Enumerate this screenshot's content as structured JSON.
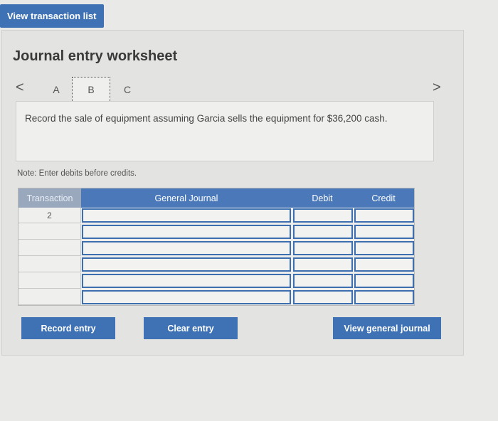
{
  "top_button": "View transaction list",
  "worksheet": {
    "title": "Journal entry worksheet",
    "nav_prev": "<",
    "nav_next": ">",
    "tabs": [
      "A",
      "B",
      "C"
    ],
    "active_tab": "B",
    "instruction": "Record the sale of equipment assuming Garcia sells the equipment for $36,200 cash.",
    "note": "Note: Enter debits before credits."
  },
  "table": {
    "headers": [
      "Transaction",
      "General Journal",
      "Debit",
      "Credit"
    ],
    "rows": [
      {
        "transaction": "2",
        "general_journal": "",
        "debit": "",
        "credit": ""
      },
      {
        "transaction": "",
        "general_journal": "",
        "debit": "",
        "credit": ""
      },
      {
        "transaction": "",
        "general_journal": "",
        "debit": "",
        "credit": ""
      },
      {
        "transaction": "",
        "general_journal": "",
        "debit": "",
        "credit": ""
      },
      {
        "transaction": "",
        "general_journal": "",
        "debit": "",
        "credit": ""
      },
      {
        "transaction": "",
        "general_journal": "",
        "debit": "",
        "credit": ""
      }
    ]
  },
  "buttons": {
    "record": "Record entry",
    "clear": "Clear entry",
    "view_journal": "View general journal"
  },
  "colors": {
    "accent": "#3e72b5",
    "header_bg": "#4a78b8"
  }
}
